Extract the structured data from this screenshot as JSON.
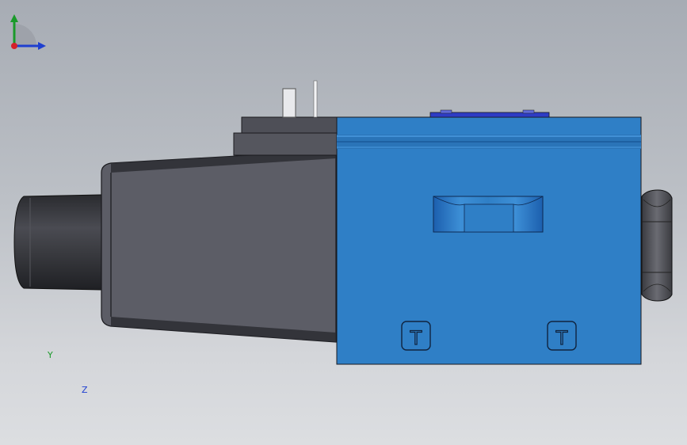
{
  "viewport": {
    "background_top": "#a7acb4",
    "background_bottom": "#dcdee1"
  },
  "model": {
    "valve_body_color": "#2f7fc6",
    "solenoid_color": "#5c5d66",
    "connector_color": "#3a3b40",
    "cover_plate_color": "#2e3cc4",
    "port_markings": [
      "T",
      "T"
    ]
  },
  "triad": {
    "y_label": "Y",
    "z_label": "Z",
    "y_color": "#1a9a2a",
    "z_color": "#1e3fd0",
    "x_color": "#d4202a"
  }
}
